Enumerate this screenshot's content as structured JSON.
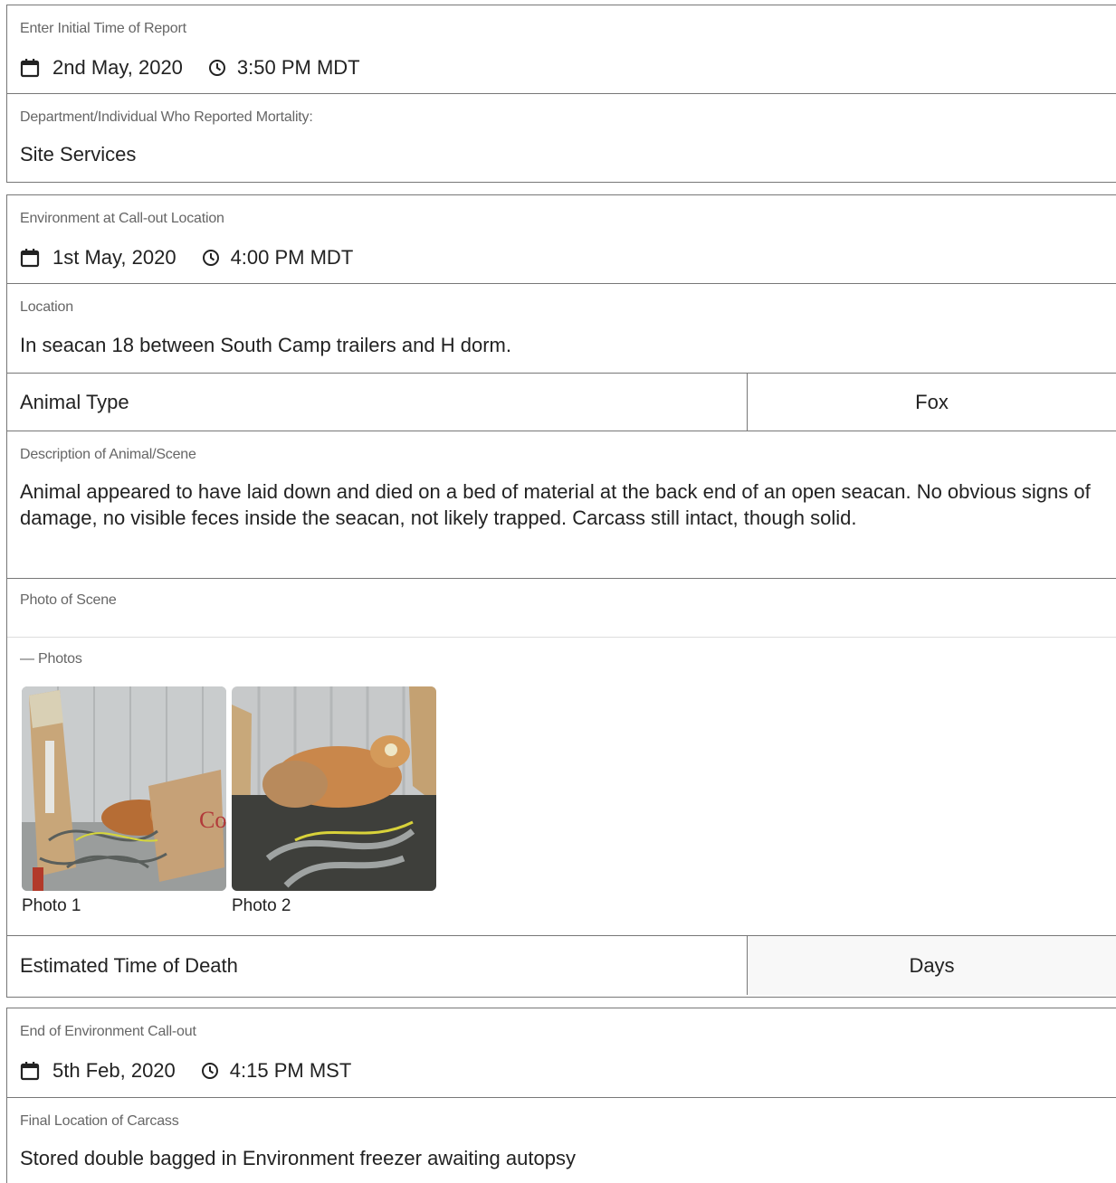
{
  "initial_report": {
    "label": "Enter Initial Time of Report",
    "date": "2nd May, 2020",
    "time": "3:50 PM MDT"
  },
  "reporter": {
    "label": "Department/Individual Who Reported Mortality:",
    "value": "Site Services"
  },
  "callout": {
    "label": "Environment at Call-out Location",
    "date": "1st May, 2020",
    "time": "4:00 PM MDT"
  },
  "location": {
    "label": "Location",
    "value": "In seacan 18 between South Camp trailers and H dorm."
  },
  "animal_type": {
    "label": "Animal Type",
    "value": "Fox"
  },
  "description": {
    "label": "Description of Animal/Scene",
    "value": "Animal appeared to have laid down and died on a bed of material at the back end of an open seacan. No obvious signs of damage, no visible feces inside the seacan, not likely trapped. Carcass still intact, though solid."
  },
  "photo_of_scene": {
    "label": "Photo of Scene"
  },
  "photos": {
    "label": "— Photos",
    "items": [
      {
        "caption": "Photo 1"
      },
      {
        "caption": "Photo 2"
      }
    ]
  },
  "time_of_death": {
    "label": "Estimated Time of Death",
    "value": "Days"
  },
  "end_callout": {
    "label": "End of Environment Call-out",
    "date": "5th Feb, 2020",
    "time": "4:15 PM MST"
  },
  "final_location": {
    "label": "Final Location of Carcass",
    "value": "Stored double bagged in Environment freezer awaiting autopsy"
  }
}
